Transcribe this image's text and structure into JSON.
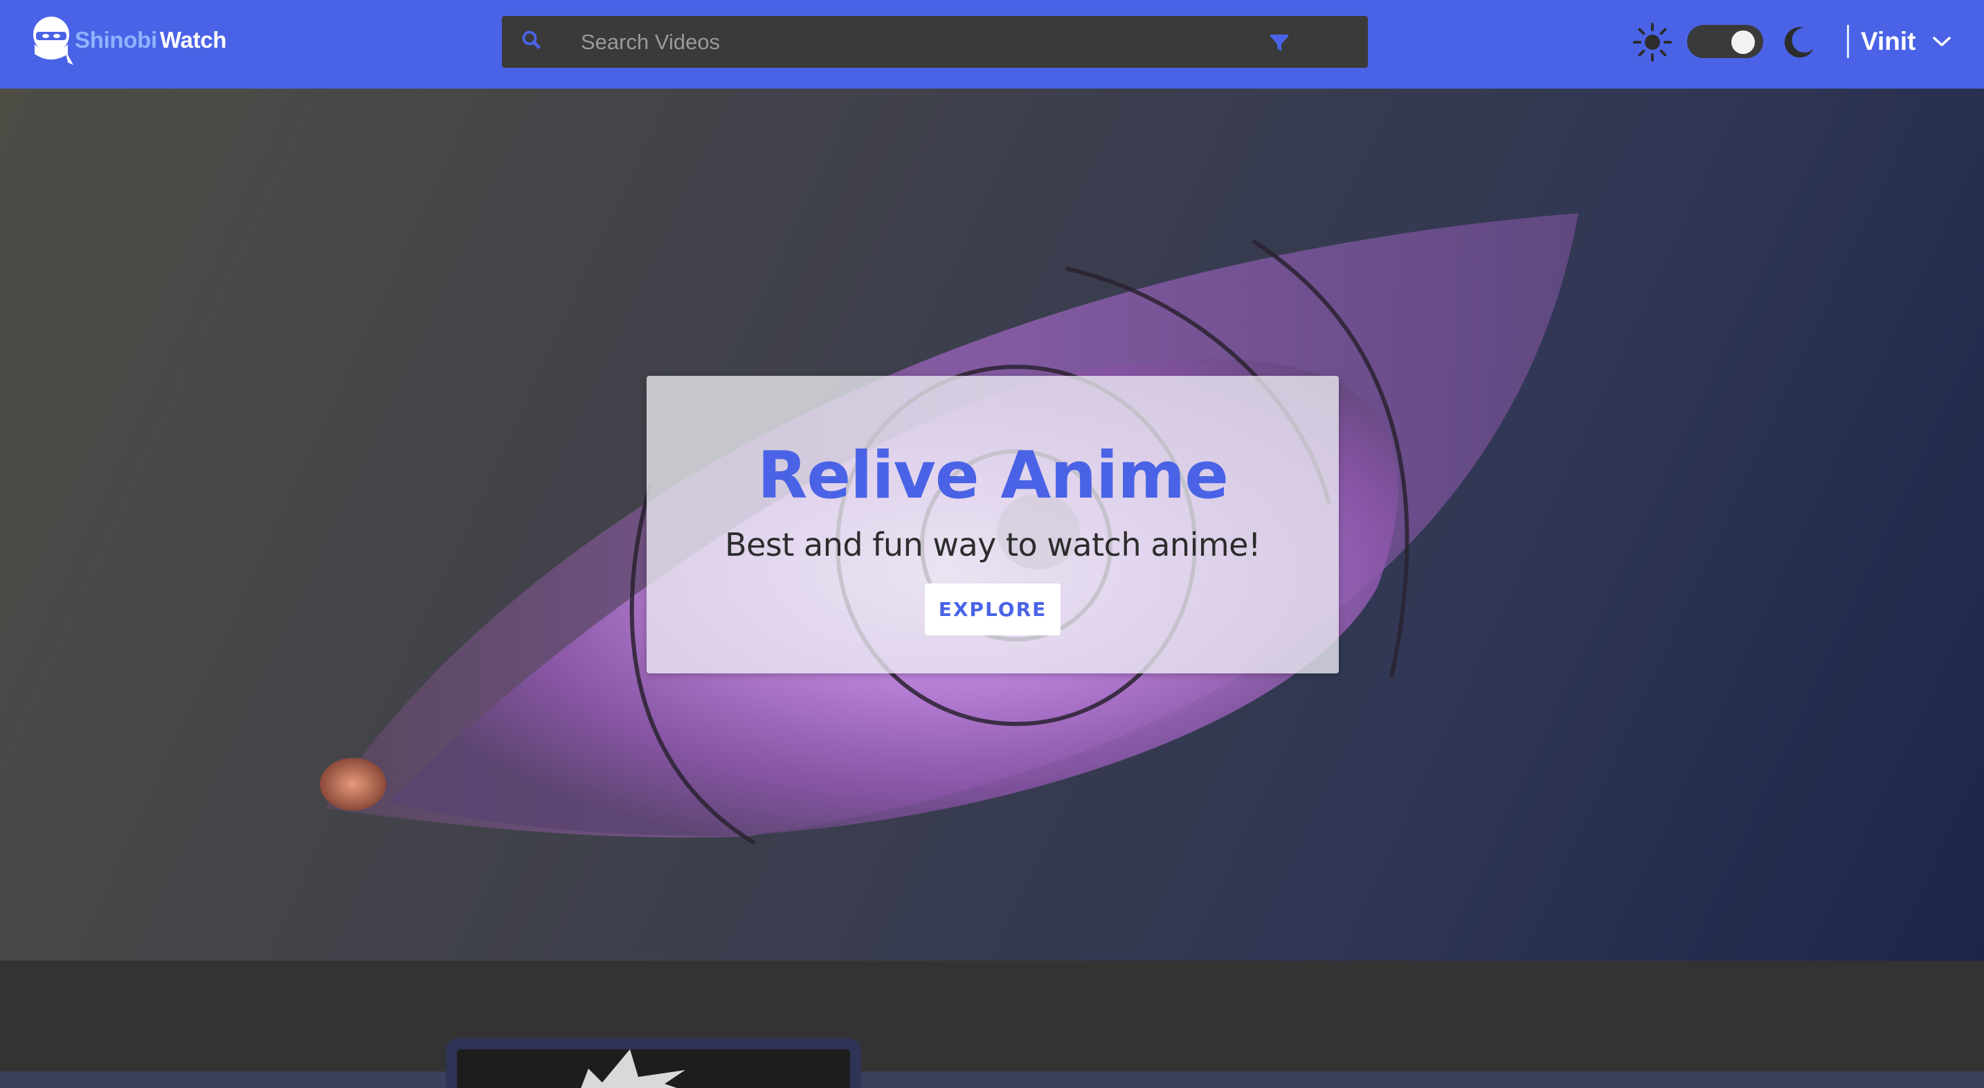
{
  "brand": {
    "part1": "Shinobi",
    "part2": "Watch",
    "accent": "#4a63e6",
    "accent_light": "#8fb3ff"
  },
  "search": {
    "placeholder": "Search Videos",
    "value": ""
  },
  "theme": {
    "light_icon": "sun-icon",
    "dark_icon": "moon-icon",
    "toggle_state": "on"
  },
  "user": {
    "name": "Vinit"
  },
  "hero": {
    "title": "Relive Anime",
    "subtitle": "Best and fun way to watch anime!",
    "button": "EXPLORE"
  },
  "colors": {
    "page_bg": "#333333",
    "card_border": "#2f3456"
  }
}
